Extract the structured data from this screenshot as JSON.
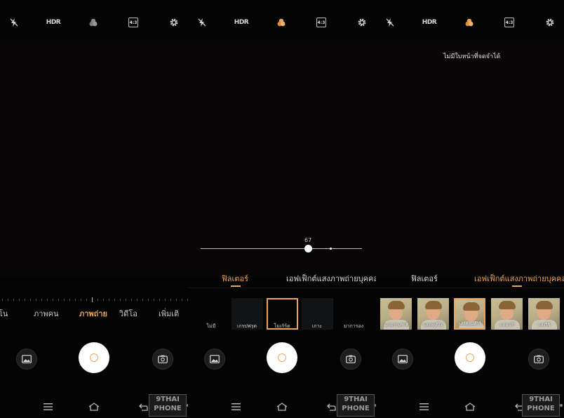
{
  "colors": {
    "accent": "#e9a55a",
    "background": "#050404",
    "text": "#d8d8d8"
  },
  "topbar": {
    "flash_icon": "flash-off-icon",
    "hdr_label": "HDR",
    "filter_icon": "filter-circles-icon",
    "ratio_label": "4:3",
    "settings_icon": "gear-icon"
  },
  "panel1": {
    "modes": [
      "โน",
      "ภาพคน",
      "ภาพถ่าย",
      "วิดีโอ",
      "เพิ่มเติ"
    ],
    "active_mode_index": 2
  },
  "panel2": {
    "slider_value": "67",
    "slider_fraction": 0.67,
    "tabs": [
      "ฟิลเตอร์",
      "เอฟเฟ็กต์แสงภาพถ่ายบุคคล"
    ],
    "active_tab_index": 0,
    "filters": [
      "ไม่มี",
      "เกรปฟรุต",
      "โมเกิร์ต",
      "เกาะ",
      "มาการอง"
    ],
    "selected_filter_index": 2
  },
  "panel3": {
    "toast": "ไม่มีใบหน้าที่จดจำได้",
    "tabs": [
      "ฟิลเตอร์",
      "เอฟเฟ็กต์แสงภาพถ่ายบุคคล"
    ],
    "active_tab_index": 1,
    "effects": [
      "แสงธรรมชาติ",
      "แสงสตูดิโอ",
      "แสงคอนทัวร์",
      "แสงเวที",
      "แสงวิจิ"
    ],
    "selected_effect_index": 2
  },
  "bottom": {
    "gallery_icon": "gallery-icon",
    "shutter_icon": "shutter-button",
    "switch_icon": "switch-camera-icon"
  },
  "navbar": {
    "menu_icon": "menu-icon",
    "home_icon": "home-icon",
    "back_icon": "back-icon"
  },
  "watermark": {
    "line1": "9THAI",
    "line2": "PHONE"
  }
}
